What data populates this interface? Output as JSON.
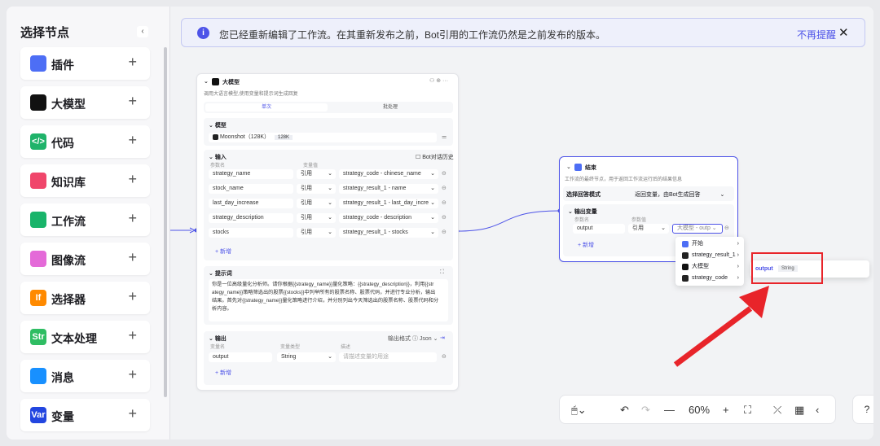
{
  "sidebar": {
    "title": "选择节点",
    "collapse_icon": "‹",
    "items": [
      {
        "label": "插件",
        "icon": "plugin-icon",
        "color": "#4d6ef5"
      },
      {
        "label": "大模型",
        "icon": "llm-icon",
        "color": "#111111"
      },
      {
        "label": "代码",
        "icon": "code-icon",
        "color": "#1fb36a",
        "glyph": "</>"
      },
      {
        "label": "知识库",
        "icon": "knowledge-icon",
        "color": "#f0466b"
      },
      {
        "label": "工作流",
        "icon": "workflow-icon",
        "color": "#19b46a"
      },
      {
        "label": "图像流",
        "icon": "imageflow-icon",
        "color": "#e46ad8"
      },
      {
        "label": "选择器",
        "icon": "selector-icon",
        "color": "#ff8a00",
        "glyph": "If"
      },
      {
        "label": "文本处理",
        "icon": "text-icon",
        "color": "#2fbd63",
        "glyph": "Str"
      },
      {
        "label": "消息",
        "icon": "message-icon",
        "color": "#1890ff"
      },
      {
        "label": "变量",
        "icon": "variable-icon",
        "color": "#2346e0",
        "glyph": "Var"
      }
    ]
  },
  "banner": {
    "message": "您已经重新编辑了工作流。在其重新发布之前，Bot引用的工作流仍然是之前发布的版本。",
    "dismiss": "不再提醒",
    "close": "✕"
  },
  "llm_node": {
    "title": "大模型",
    "desc": "调用大语言模型,使用变量和提示词生成回复",
    "tab_single": "单次",
    "tab_batch": "批处理",
    "model_section": "模型",
    "model_name": "Moonshot（128K）",
    "model_tag": "128K",
    "input_section": "输入",
    "bot_history": "Bot对话历史",
    "col_param": "参数名",
    "col_value": "变量值",
    "inputs": [
      {
        "name": "strategy_name",
        "mode": "引用",
        "value": "strategy_code - chinese_name"
      },
      {
        "name": "stock_name",
        "mode": "引用",
        "value": "strategy_result_1 - name"
      },
      {
        "name": "last_day_increase",
        "mode": "引用",
        "value": "strategy_result_1 - last_day_incre"
      },
      {
        "name": "strategy_description",
        "mode": "引用",
        "value": "strategy_code - description"
      },
      {
        "name": "stocks",
        "mode": "引用",
        "value": "strategy_result_1 - stocks"
      }
    ],
    "add_label": "+ 新增",
    "prompt_section": "提示词",
    "prompt_lines": [
      "你是一位高级量化分析师。请你根据{{strategy_name}}量化策略：{{strategy_description}}，利用{{str",
      "ategy_name}}策略筛选出的股票{{stocks}}中列举所有的股票名称、股票代码，并进行专业分析，输出",
      "结果。首先对{{strategy_name}}量化策略进行介绍，并分别列出今天筛选出的股票名称、股票代码和分",
      "析内容。"
    ],
    "output_section": "输出",
    "output_format_label": "输出格式",
    "output_format": "Json",
    "col_var": "变量名",
    "col_type": "变量类型",
    "col_desc": "描述",
    "output_name": "output",
    "output_type": "String",
    "output_desc_placeholder": "请描述变量的用途"
  },
  "end_node": {
    "title": "结束",
    "desc": "工作流的最终节点，用于返回工作流运行后的结果信息",
    "mode_label": "选择回答模式",
    "mode_value": "返回变量，由Bot生成回答",
    "output_section": "输出变量",
    "col_param": "参数名",
    "col_value": "参数值",
    "var_name": "output",
    "var_mode": "引用",
    "var_value": "大模型 - outp",
    "add_label": "+ 新增"
  },
  "dropdown": {
    "items": [
      {
        "label": "开始",
        "color": "#4d6ef5"
      },
      {
        "label": "strategy_result_1",
        "color": "#222222"
      },
      {
        "label": "大模型",
        "color": "#111111"
      },
      {
        "label": "strategy_code",
        "color": "#222222"
      }
    ],
    "popout_name": "output",
    "popout_type": "String"
  },
  "zoom": {
    "level": "60%"
  },
  "help_icon": "?"
}
